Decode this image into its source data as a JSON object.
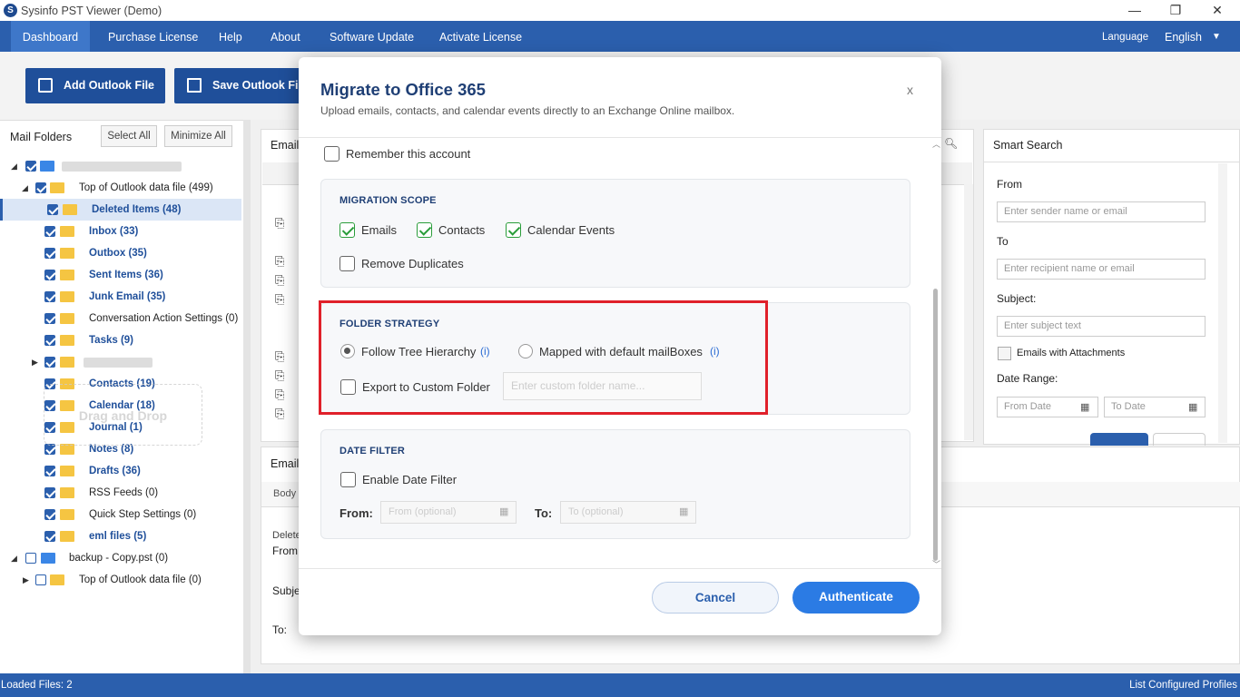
{
  "window": {
    "title": "Sysinfo PST Viewer (Demo)",
    "logo_letter": "S"
  },
  "menu": {
    "items": [
      "Dashboard",
      "Purchase License",
      "Help",
      "About",
      "Software Update",
      "Activate License"
    ],
    "language_label": "Language",
    "language_value": "English"
  },
  "toolbar": {
    "add_label": "Add Outlook File",
    "save_label": "Save Outlook File"
  },
  "left": {
    "title": "Mail Folders",
    "select_all": "Select All",
    "minimize_all": "Minimize All",
    "drag_hint": "Drag and Drop",
    "tree": [
      {
        "label": "Top of Outlook data file (499)"
      },
      {
        "label": "Deleted Items (48)"
      },
      {
        "label": "Inbox (33)"
      },
      {
        "label": "Outbox (35)"
      },
      {
        "label": "Sent Items (36)"
      },
      {
        "label": "Junk Email (35)"
      },
      {
        "label": "Conversation Action Settings (0)"
      },
      {
        "label": "Tasks (9)"
      },
      {
        "label": "Contacts (19)"
      },
      {
        "label": "Calendar (18)"
      },
      {
        "label": "Journal (1)"
      },
      {
        "label": "Notes (8)"
      },
      {
        "label": "Drafts (36)"
      },
      {
        "label": "RSS Feeds (0)"
      },
      {
        "label": "Quick Step Settings (0)"
      },
      {
        "label": "eml files (5)"
      },
      {
        "label": "backup - Copy.pst (0)"
      },
      {
        "label": "Top of Outlook data file (0)"
      }
    ]
  },
  "middle": {
    "header": "Email",
    "lower_header": "Email",
    "tab_body": "Body",
    "preview_deleted": "Delete",
    "preview_from": "From",
    "preview_subject": "Subje",
    "preview_to": "To:"
  },
  "search": {
    "title": "Smart Search",
    "from_label": "From",
    "from_placeholder": "Enter sender name or email",
    "to_label": "To",
    "to_placeholder": "Enter recipient name or email",
    "subject_label": "Subject:",
    "subject_placeholder": "Enter subject text",
    "attachments_label": "Emails with Attachments",
    "date_range_label": "Date Range:",
    "from_date": "From Date",
    "to_date": "To Date"
  },
  "status": {
    "loaded": "Loaded Files: 2",
    "profiles": "List Configured Profiles"
  },
  "modal": {
    "title": "Migrate to Office 365",
    "subtitle": "Upload emails, contacts, and calendar events directly to an Exchange Online mailbox.",
    "close": "x",
    "remember": "Remember this account",
    "scope": {
      "title": "MIGRATION SCOPE",
      "emails": "Emails",
      "contacts": "Contacts",
      "calendar": "Calendar Events",
      "remove_duplicates": "Remove Duplicates"
    },
    "strategy": {
      "title": "FOLDER STRATEGY",
      "follow_tree": "Follow Tree Hierarchy",
      "mapped": "Mapped with default mailBoxes",
      "info": "(i)",
      "export_custom": "Export to Custom Folder",
      "custom_placeholder": "Enter custom folder name..."
    },
    "date_filter": {
      "title": "DATE FILTER",
      "enable": "Enable Date Filter",
      "from_label": "From:",
      "from_placeholder": "From (optional)",
      "to_label": "To:",
      "to_placeholder": "To (optional)"
    },
    "cancel": "Cancel",
    "authenticate": "Authenticate"
  },
  "colors": {
    "accent": "#2b5fad",
    "primary_button": "#2b7be4",
    "highlight": "#e0202a",
    "check_green": "#2a9d3a"
  }
}
